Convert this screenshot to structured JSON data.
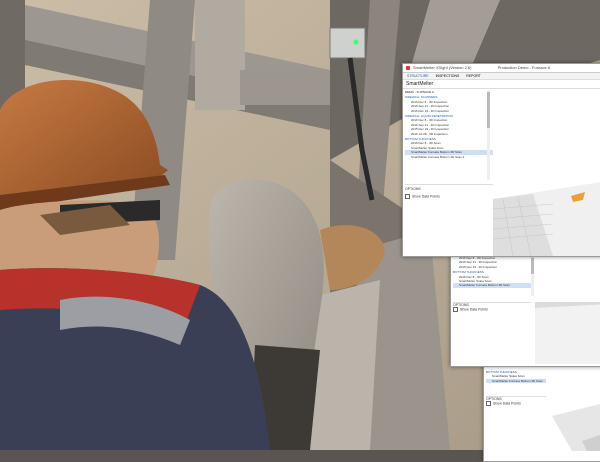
{
  "app": {
    "title": "SmartMelter XSight (Version 2.6)",
    "subtitle": "Production Demo - Furnace A",
    "tabs": [
      {
        "label": "STRUCTURE"
      },
      {
        "label": "INSPECTIONS"
      },
      {
        "label": "REPORT"
      }
    ],
    "breadcrumb": "SmartMelter",
    "tree_header": "DEMO - FURNACE A",
    "tree_items": [
      {
        "label": "SIDEWALL SCANNERS",
        "group": true
      },
      {
        "label": "2016 Dec 8 - 3D Inspection"
      },
      {
        "label": "2016 Sep 21 - 3D Inspection"
      },
      {
        "label": "2015 Dec 19 - 3D Inspection"
      },
      {
        "label": "SIDEWALL LIQUID PENETRATION",
        "group": true
      },
      {
        "label": "2016 Dec 8 - 3D Inspection"
      },
      {
        "label": "2016 Sep 21 - 3D Inspection"
      },
      {
        "label": "2015 Dec 19 - 3D Inspection"
      },
      {
        "label": "2016 Jul 28 - 3D Inspection"
      },
      {
        "label": "BOTTOM THICKNESS",
        "group": true
      },
      {
        "label": "2016 Dec 8 - 3D Scan"
      },
      {
        "label": "SmartMelter Sidea Scan"
      },
      {
        "label": "SmartMelter Furnace Bottom 3D Scan",
        "selected": true
      },
      {
        "label": "SmartMelter Furnace Bottom 3D Scan 2"
      }
    ],
    "options_label": "OPTIONS",
    "option_checkbox": "Show Data Points"
  }
}
